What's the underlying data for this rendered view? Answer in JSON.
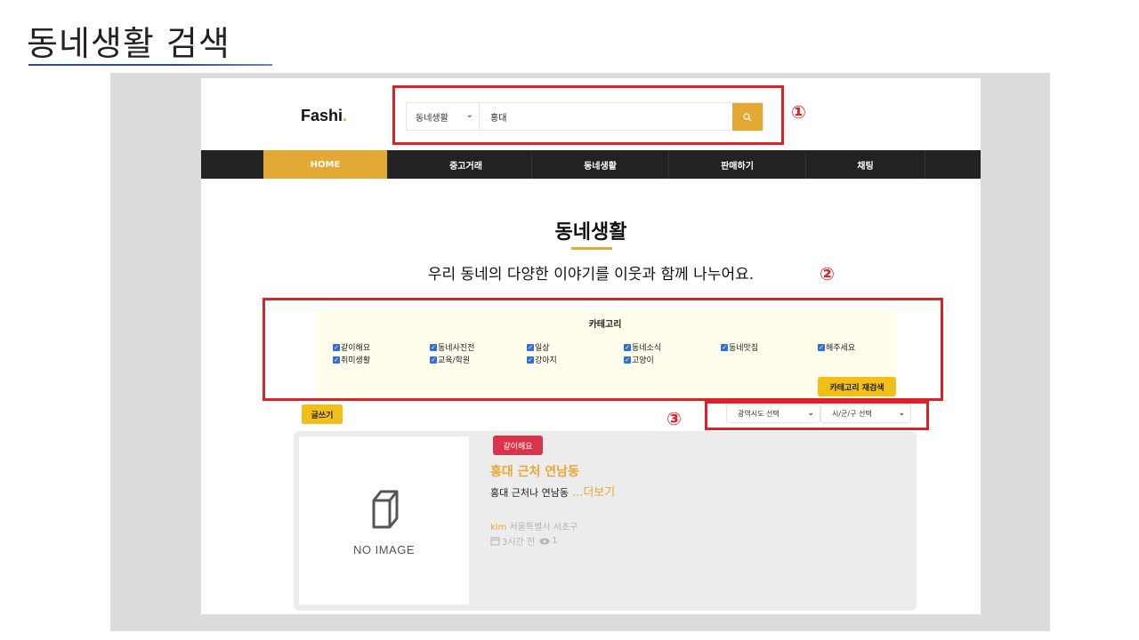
{
  "slide": {
    "title": "동네생활 검색"
  },
  "header": {
    "logo_text": "Fashi",
    "logo_dot": ".",
    "search": {
      "category": "동네생활",
      "query": "홍대"
    }
  },
  "nav": {
    "items": [
      "HOME",
      "중고거래",
      "동네생활",
      "판매하기",
      "채팅"
    ]
  },
  "section": {
    "title": "동네생활",
    "subtitle": "우리 동네의 다양한 이야기를 이웃과 함께 나누어요."
  },
  "categories": {
    "title": "카테고리",
    "items": [
      "같이해요",
      "동네사진전",
      "일상",
      "동네소식",
      "동네맛집",
      "해주세요",
      "취미생활",
      "교육/학원",
      "강아지",
      "고양이"
    ],
    "button": "카테고리 재검색"
  },
  "toolbar": {
    "write_label": "글쓰기",
    "region_province": "광역시도 선택",
    "region_city": "시/군/구 선택"
  },
  "post": {
    "no_image": "NO IMAGE",
    "badge": "같이해요",
    "title": "홍대 근처 연남동",
    "body": "홍대 근처나 연남동",
    "more": "...더보기",
    "author": "kim",
    "location": "서울특별시 서초구",
    "time": "3시간 전",
    "views": "1"
  },
  "annotations": [
    "①",
    "②",
    "③"
  ],
  "colors": {
    "accent": "#e4a935",
    "yellow": "#f2be1a",
    "nav_bg": "#222222",
    "badge": "#d9354a",
    "annotation": "#d8232a"
  }
}
